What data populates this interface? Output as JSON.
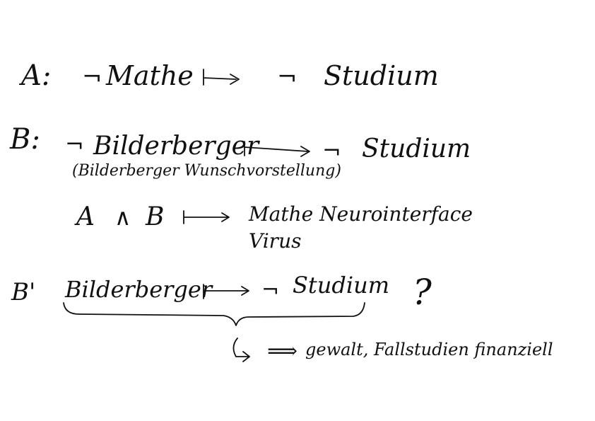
{
  "note": {
    "line_a": {
      "label": "A:",
      "neg_1": "¬",
      "premise": "Mathe",
      "neg_2": "¬",
      "conclusion": "Studium"
    },
    "line_b": {
      "label": "B:",
      "neg_1": "¬",
      "premise": "Bilderberger",
      "neg_2": "¬",
      "conclusion": "Studium",
      "note": "(Bilderberger Wunschvorstellung)"
    },
    "line_ab": {
      "a": "A",
      "and": "∧",
      "b": "B",
      "result": "Mathe Neurointerface",
      "result_2": "Virus"
    },
    "line_b_prime": {
      "label": "B'",
      "premise": "Bilderberger",
      "neg": "¬",
      "conclusion": "Studium",
      "question": "?",
      "implies": "⟹",
      "consequence": "gewalt, Fallstudien finanziell"
    }
  }
}
